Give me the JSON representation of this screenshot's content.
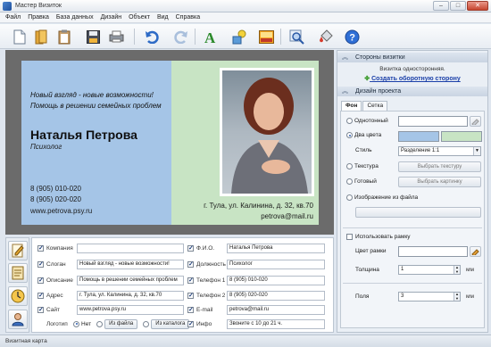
{
  "window": {
    "title": "Мастер Визиток",
    "minimize": "–",
    "maximize": "□",
    "close": "✕"
  },
  "menu": [
    "Файл",
    "Правка",
    "База данных",
    "Дизайн",
    "Объект",
    "Вид",
    "Справка"
  ],
  "toolbar": {
    "icons": [
      "new-document-icon",
      "open-folder-icon",
      "clipboard-icon",
      "save-icon",
      "print-icon",
      "undo-icon",
      "redo-icon",
      "text-icon",
      "shapes-icon",
      "image-icon",
      "zoom-icon",
      "paint-icon",
      "help-icon"
    ]
  },
  "card": {
    "slogan": "Новый взгляд - новые возможности!",
    "description": "Помощь в решении семейных проблем",
    "fio": "Наталья Петрова",
    "post": "Психолог",
    "phone1": "8 (905) 010-020",
    "phone2": "8 (905) 020-020",
    "site": "www.petrova.psy.ru",
    "address": "г. Тула, ул. Калинина, д. 32, кв.70",
    "email": "petrova@mail.ru",
    "colors": {
      "left": "#a5c5e7",
      "right": "#c8e4c4"
    }
  },
  "fields": {
    "left": [
      {
        "label": "Компания",
        "value": ""
      },
      {
        "label": "Слоган",
        "value": "Новый взгляд - новые возможности!"
      },
      {
        "label": "Описание",
        "value": "Помощь в решении семейных проблем"
      },
      {
        "label": "Адрес",
        "value": "г. Тула, ул. Калинина, д. 32, кв.70"
      },
      {
        "label": "Сайт",
        "value": "www.petrova.psy.ru"
      }
    ],
    "right": [
      {
        "label": "Ф.И.О.",
        "value": "Наталья Петрова"
      },
      {
        "label": "Должность",
        "value": "Психолог"
      },
      {
        "label": "Телефон 1",
        "value": "8 (905) 010-020"
      },
      {
        "label": "Телефон 2",
        "value": "8 (905) 020-020"
      },
      {
        "label": "E-mail",
        "value": "petrova@mail.ru"
      },
      {
        "label": "Инфо",
        "value": "Звоните с 10 до 21 ч."
      }
    ],
    "logo": {
      "label": "Логотип",
      "none": "Нет",
      "from_file": "Из файла",
      "from_catalog": "Из каталога"
    }
  },
  "right_panel": {
    "sides_header": "Стороны визитки",
    "one_sided": "Визитка односторонняя.",
    "create_back_link": "Создать оборотную сторону",
    "design_header": "Дизайн проекта",
    "tabs": [
      "Фон",
      "Сетка"
    ],
    "background": {
      "solid": "Однотонный",
      "two_colors": "Два цвета",
      "style_label": "Стиль",
      "style_value": "Разделение 1:1",
      "texture": "Текстура",
      "choose_texture": "Выбрать текстуру",
      "ready": "Готовый",
      "choose_picture": "Выбрать картинку",
      "from_file": "Изображение из файла",
      "color_a": "#a5c5e7",
      "color_b": "#c8e4c4"
    },
    "frame": {
      "use": "Использовать рамку",
      "color_label": "Цвет рамки",
      "thickness_label": "Толщина",
      "thickness_value": "1",
      "thickness_unit": "мм"
    },
    "margins": {
      "label": "Поля",
      "value": "3",
      "unit": "мм"
    }
  },
  "status": "Визитная карта"
}
